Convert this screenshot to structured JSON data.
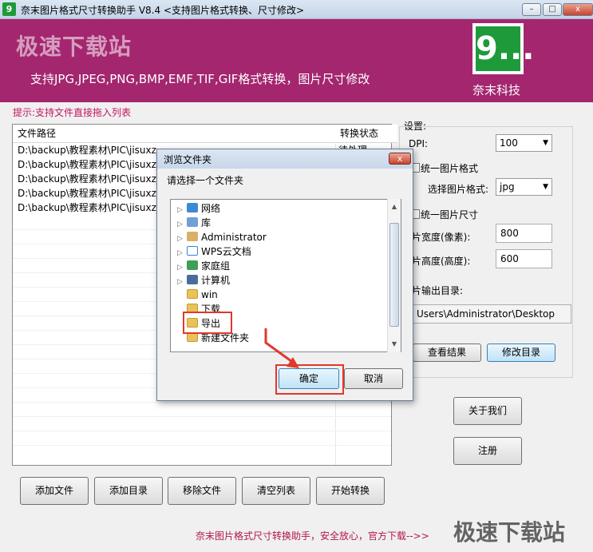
{
  "window": {
    "app_icon_text": "9",
    "title": "奈末图片格式尺寸转换助手 V8.4     <支持图片格式转换、尺寸修改>",
    "controls": {
      "minimize": "–",
      "maximize": "□",
      "close": "x"
    }
  },
  "banner": {
    "watermark": "极速下载站",
    "slogan": "支持JPG,JPEG,PNG,BMP,EMF,TIF,GIF格式转换，图片尺寸修改",
    "logo_text": "9...",
    "company": "奈末科技",
    "color": "#a3266f"
  },
  "hint": "提示:支持文件直接拖入列表",
  "file_list": {
    "columns": [
      "文件路径",
      "转换状态"
    ],
    "rows": [
      {
        "path": "D:\\backup\\教程素材\\PIC\\jisuxz_",
        "status": "待处理"
      },
      {
        "path": "D:\\backup\\教程素材\\PIC\\jisuxz_",
        "status": ""
      },
      {
        "path": "D:\\backup\\教程素材\\PIC\\jisuxz_",
        "status": ""
      },
      {
        "path": "D:\\backup\\教程素材\\PIC\\jisuxz_",
        "status": ""
      },
      {
        "path": "D:\\backup\\教程素材\\PIC\\jisuxz_",
        "status": ""
      }
    ]
  },
  "settings": {
    "title": "设置:",
    "dpi_label": "DPI:",
    "dpi_value": "100",
    "unify_format_label": "统一图片格式",
    "select_format_label": "选择图片格式:",
    "format_value": "jpg",
    "unify_size_label": "统一图片尺寸",
    "width_label": "片宽度(像素):",
    "width_value": "800",
    "height_label": "片高度(高度):",
    "height_value": "600",
    "output_dir_label": "片输出目录:",
    "output_dir_value": "Users\\Administrator\\Desktop",
    "view_result": "查看结果",
    "modify_dir": "修改目录"
  },
  "side_buttons": {
    "about": "关于我们",
    "register": "注册"
  },
  "bottom_buttons": [
    "添加文件",
    "添加目录",
    "移除文件",
    "清空列表",
    "开始转换"
  ],
  "footer": {
    "text": "奈末图片格式尺寸转换助手，安全放心，官方下载-->>",
    "watermark": "极速下载站"
  },
  "dialog": {
    "title": "浏览文件夹",
    "close": "x",
    "prompt": "请选择一个文件夹",
    "tree": [
      {
        "label": "网络",
        "icon": "network-icon",
        "expandable": true
      },
      {
        "label": "库",
        "icon": "library-icon",
        "expandable": true
      },
      {
        "label": "Administrator",
        "icon": "user-folder-icon",
        "expandable": true
      },
      {
        "label": "WPS云文档",
        "icon": "cloud-icon",
        "expandable": true
      },
      {
        "label": "家庭组",
        "icon": "homegroup-icon",
        "expandable": true
      },
      {
        "label": "计算机",
        "icon": "computer-icon",
        "expandable": true
      },
      {
        "label": "win",
        "icon": "folder-icon",
        "expandable": false
      },
      {
        "label": "下载",
        "icon": "folder-icon",
        "expandable": false
      },
      {
        "label": "导出",
        "icon": "folder-icon",
        "expandable": false,
        "selected": true
      },
      {
        "label": "新建文件夹",
        "icon": "folder-icon",
        "expandable": false
      }
    ],
    "ok": "确定",
    "cancel": "取消",
    "highlight_color": "#e0392b"
  }
}
